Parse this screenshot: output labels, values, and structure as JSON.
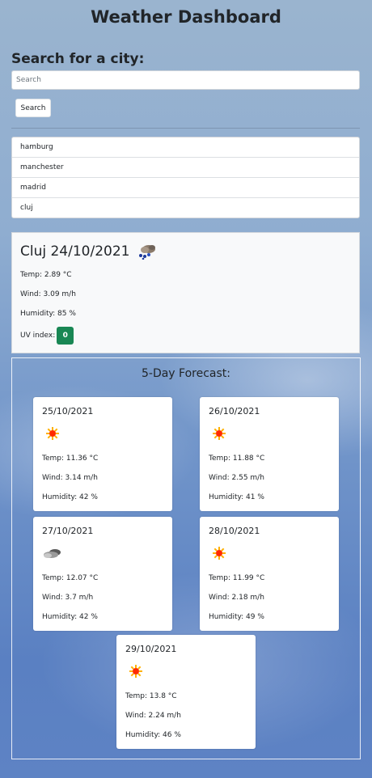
{
  "header": {
    "title": "Weather Dashboard"
  },
  "search": {
    "heading": "Search for a city:",
    "placeholder": "Search",
    "button_label": "Search"
  },
  "history": {
    "items": [
      "hamburg",
      "manchester",
      "madrid",
      "cluj"
    ]
  },
  "current": {
    "heading": "Cluj 24/10/2021",
    "icon": "rain-cloud-icon",
    "temp": "Temp: 2.89 °C",
    "wind": "Wind: 3.09 m/h",
    "humidity": "Humidity: 85 %",
    "uv_label": "UV index:",
    "uv_value": "0",
    "uv_color": "#198754"
  },
  "forecast": {
    "title": "5-Day Forecast:",
    "days": [
      {
        "date": "25/10/2021",
        "icon": "sun-icon",
        "temp": "Temp: 11.36 °C",
        "wind": "Wind: 3.14 m/h",
        "humidity": "Humidity: 42 %"
      },
      {
        "date": "26/10/2021",
        "icon": "sun-icon",
        "temp": "Temp: 11.88 °C",
        "wind": "Wind: 2.55 m/h",
        "humidity": "Humidity: 41 %"
      },
      {
        "date": "27/10/2021",
        "icon": "cloud-icon",
        "temp": "Temp: 12.07 °C",
        "wind": "Wind: 3.7 m/h",
        "humidity": "Humidity: 42 %"
      },
      {
        "date": "28/10/2021",
        "icon": "sun-icon",
        "temp": "Temp: 11.99 °C",
        "wind": "Wind: 2.18 m/h",
        "humidity": "Humidity: 49 %"
      },
      {
        "date": "29/10/2021",
        "icon": "sun-icon",
        "temp": "Temp: 13.8 °C",
        "wind": "Wind: 2.24 m/h",
        "humidity": "Humidity: 46 %"
      }
    ]
  }
}
